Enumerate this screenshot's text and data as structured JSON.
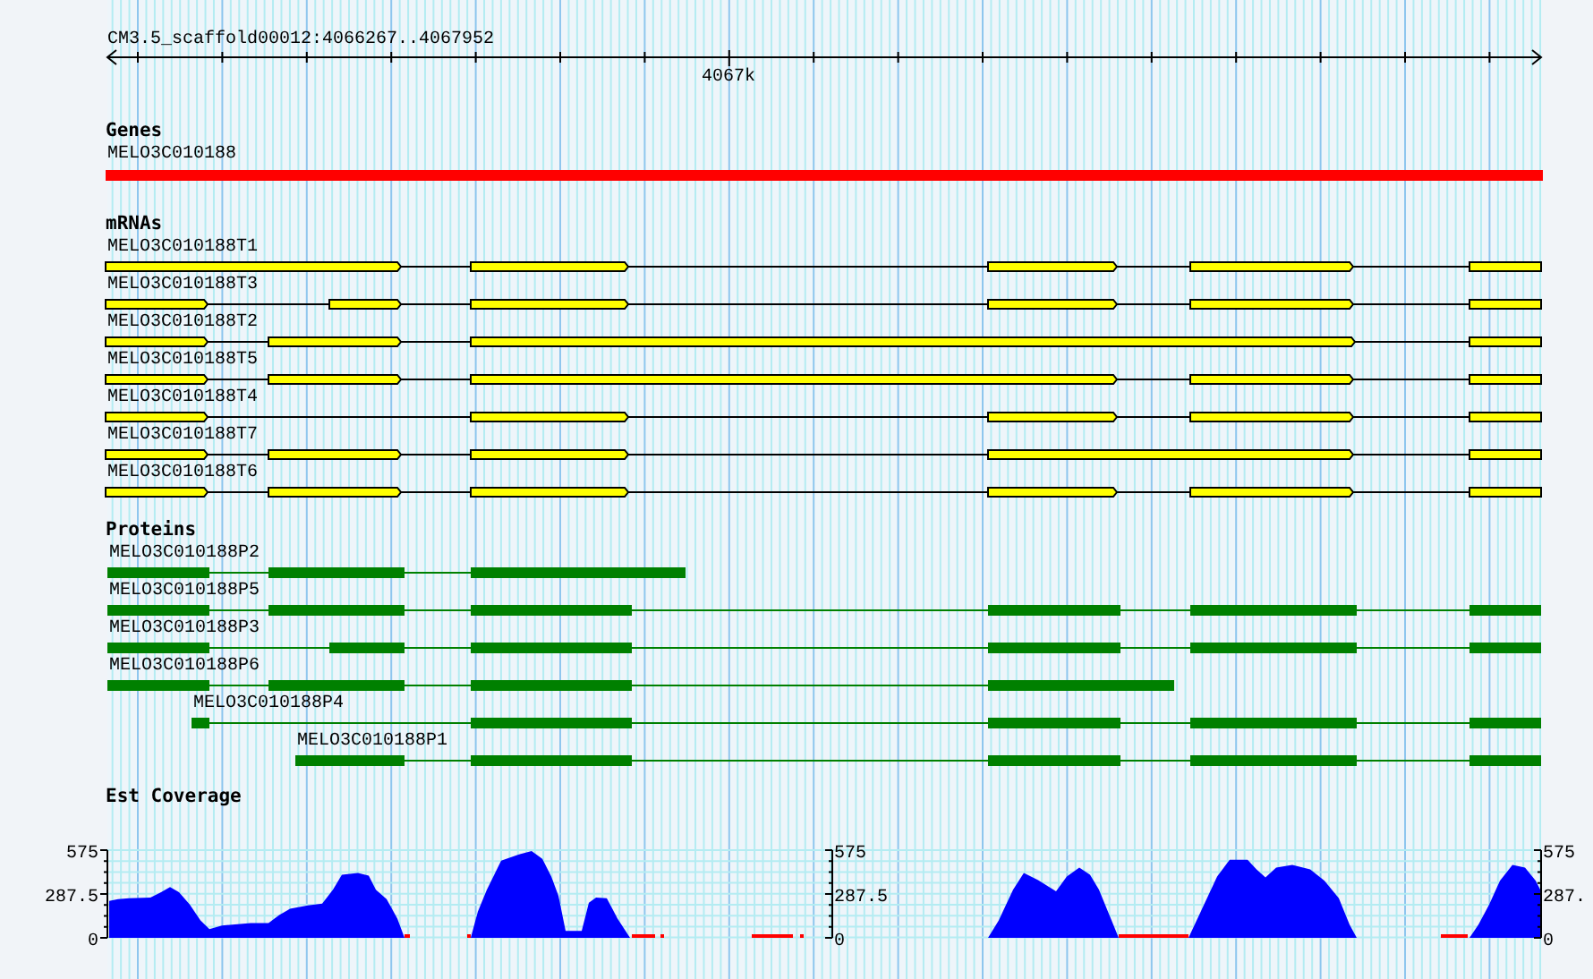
{
  "ruler": {
    "title": "CM3.5_scaffold00012:4066267..4067952",
    "tick_label": "4067k"
  },
  "tracks": [
    {
      "kind": "gene",
      "title": "Genes",
      "features": [
        {
          "label": "MELO3C010188"
        }
      ]
    },
    {
      "kind": "mrna",
      "title": "mRNAs",
      "features": [
        {
          "label": "MELO3C010188T1"
        },
        {
          "label": "MELO3C010188T3"
        },
        {
          "label": "MELO3C010188T2"
        },
        {
          "label": "MELO3C010188T5"
        },
        {
          "label": "MELO3C010188T4"
        },
        {
          "label": "MELO3C010188T7"
        },
        {
          "label": "MELO3C010188T6"
        }
      ]
    },
    {
      "kind": "protein",
      "title": "Proteins",
      "features": [
        {
          "label": "MELO3C010188P2"
        },
        {
          "label": "MELO3C010188P5"
        },
        {
          "label": "MELO3C010188P3"
        },
        {
          "label": "MELO3C010188P6"
        },
        {
          "label": "MELO3C010188P4"
        },
        {
          "label": "MELO3C010188P1"
        }
      ]
    },
    {
      "kind": "coverage",
      "title": "Est Coverage",
      "panels": [
        {
          "ticks": [
            "575",
            "287.5",
            "0"
          ]
        },
        {
          "ticks": [
            "575",
            "287.5",
            "0"
          ]
        },
        {
          "ticks": [
            "575",
            "287.",
            "0"
          ]
        }
      ]
    }
  ]
}
